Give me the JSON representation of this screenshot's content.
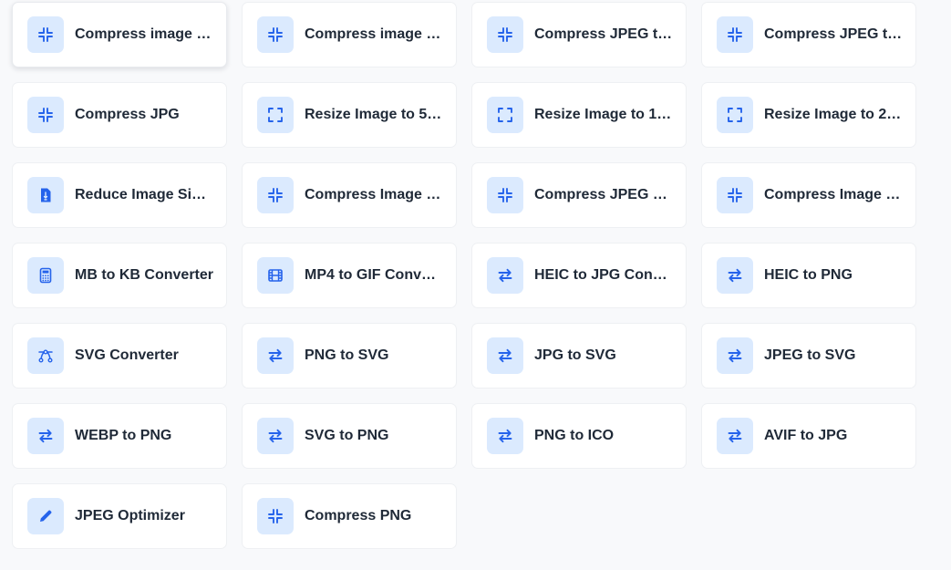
{
  "accent_color": "#2563eb",
  "icon_bg_color": "#dbeafe",
  "tools": [
    {
      "label": "Compress image t...",
      "icon": "compress-icon"
    },
    {
      "label": "Compress image t...",
      "icon": "compress-icon"
    },
    {
      "label": "Compress JPEG to ...",
      "icon": "compress-icon"
    },
    {
      "label": "Compress JPEG to ...",
      "icon": "compress-icon"
    },
    {
      "label": "Compress JPG",
      "icon": "compress-icon"
    },
    {
      "label": "Resize Image to 50...",
      "icon": "resize-icon"
    },
    {
      "label": "Resize Image to 10...",
      "icon": "resize-icon"
    },
    {
      "label": "Resize Image to 20...",
      "icon": "resize-icon"
    },
    {
      "label": "Reduce Image Size...",
      "icon": "file-size-icon"
    },
    {
      "label": "Compress Image T...",
      "icon": "compress-icon"
    },
    {
      "label": "Compress JPEG To ...",
      "icon": "compress-icon"
    },
    {
      "label": "Compress Image T...",
      "icon": "compress-icon"
    },
    {
      "label": "MB to KB Converter",
      "icon": "calculator-icon"
    },
    {
      "label": "MP4 to GIF Conver...",
      "icon": "film-icon"
    },
    {
      "label": "HEIC to JPG Conve...",
      "icon": "convert-arrows-icon"
    },
    {
      "label": "HEIC to PNG",
      "icon": "convert-arrows-icon"
    },
    {
      "label": "SVG Converter",
      "icon": "bezier-curve-icon"
    },
    {
      "label": "PNG to SVG",
      "icon": "convert-arrows-icon"
    },
    {
      "label": "JPG to SVG",
      "icon": "convert-arrows-icon"
    },
    {
      "label": "JPEG to SVG",
      "icon": "convert-arrows-icon"
    },
    {
      "label": "WEBP to PNG",
      "icon": "convert-arrows-icon"
    },
    {
      "label": "SVG to PNG",
      "icon": "convert-arrows-icon"
    },
    {
      "label": "PNG to ICO",
      "icon": "convert-arrows-icon"
    },
    {
      "label": "AVIF to JPG",
      "icon": "convert-arrows-icon"
    },
    {
      "label": "JPEG Optimizer",
      "icon": "pencil-icon"
    },
    {
      "label": "Compress PNG",
      "icon": "compress-icon"
    }
  ]
}
